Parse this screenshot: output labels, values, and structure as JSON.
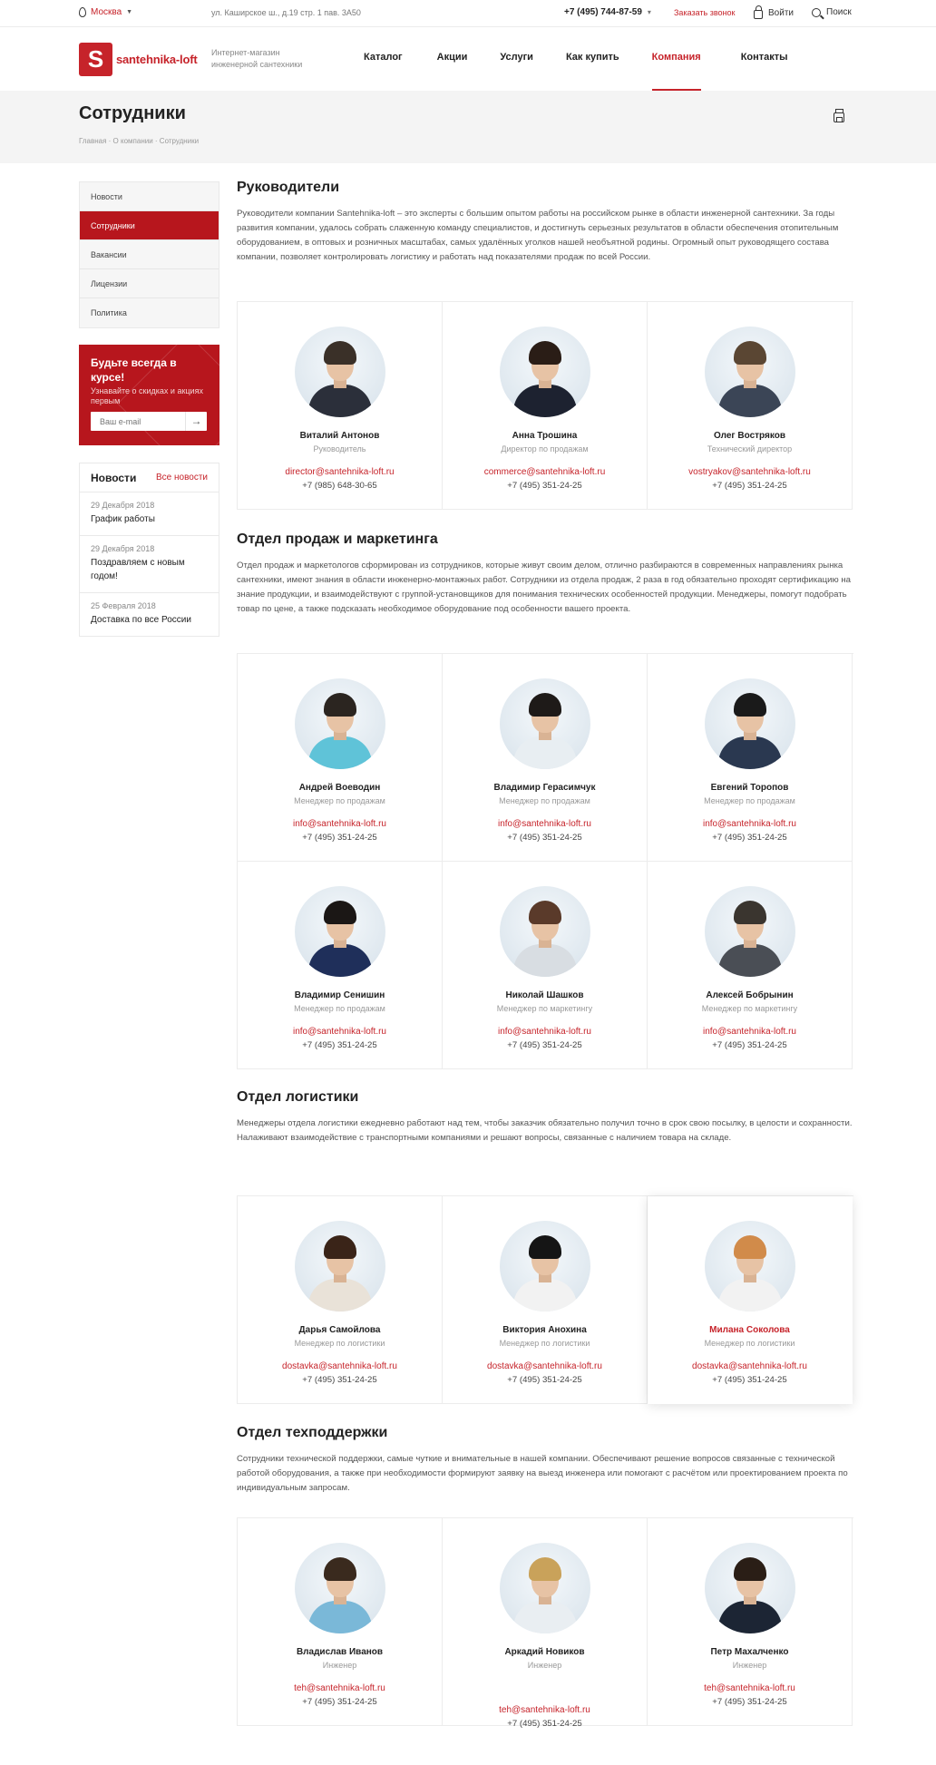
{
  "topbar": {
    "city": "Москва",
    "address": "ул. Каширское ш., д.19 стр. 1 пав. 3А50",
    "phone": "+7 (495) 744-87-59",
    "callback": "Заказать звонок",
    "login": "Войти",
    "search": "Поиск"
  },
  "header": {
    "logo_letter": "S",
    "logo_name": "santehnika-loft",
    "tagline": "Интернет-магазин инженерной сантехники",
    "nav": [
      "Каталог",
      "Акции",
      "Услуги",
      "Как купить",
      "Компания",
      "Контакты"
    ],
    "nav_active": "Компания"
  },
  "page": {
    "title": "Сотрудники",
    "breadcrumb": "Главная  ·  О компании  ·  Сотрудники"
  },
  "sidebar": {
    "menu": [
      "Новости",
      "Сотрудники",
      "Вакансии",
      "Лицензии",
      "Политика"
    ],
    "menu_active": "Сотрудники",
    "subscribe_title": "Будьте всегда в курсе!",
    "subscribe_desc": "Узнавайте о скидках и акциях первым",
    "email_placeholder": "Ваш e-mail",
    "news_title": "Новости",
    "news_all": "Все новости",
    "news": [
      {
        "date": "29 Декабря 2018",
        "title": "График работы"
      },
      {
        "date": "29 Декабря 2018",
        "title": "Поздравляем с новым годом!"
      },
      {
        "date": "25 Февраля 2018",
        "title": "Доставка по все России"
      }
    ]
  },
  "sections": [
    {
      "title": "Руководители",
      "desc": "Руководители компании Santehnika-loft – это эксперты с большим опытом работы на российском рынке в области инженерной сантехники. За годы развития компании, удалось собрать слаженную команду специалистов, и достигнуть серьезных результатов в области обеспечения отопительным оборудованием, в оптовых и розничных масштабах, самых удалённых уголков нашей необъятной родины. Огромный опыт руководящего состава компании, позволяет контролировать логистику и работать над показателями продаж по всей России.",
      "people": [
        {
          "name": "Виталий Антонов",
          "position": "Руководитель",
          "email": "director@santehnika-loft.ru",
          "phone": "+7 (985) 648-30-65"
        },
        {
          "name": "Анна Трошина",
          "position": "Директор по продажам",
          "email": "commerce@santehnika-loft.ru",
          "phone": "+7 (495) 351-24-25"
        },
        {
          "name": "Олег Востряков",
          "position": "Технический директор",
          "email": "vostryakov@santehnika-loft.ru",
          "phone": "+7 (495) 351-24-25"
        }
      ]
    },
    {
      "title": "Отдел продаж и маркетинга",
      "desc": "Отдел продаж и маркетологов сформирован из сотрудников, которые живут своим делом, отлично разбираются в современных направлениях рынка сантехники, имеют знания в области инженерно-монтажных работ. Сотрудники из отдела продаж, 2 раза в год обязательно проходят сертификацию на знание продукции, и взаимодействуют с группой-установщиков для понимания технических особенностей продукции. Менеджеры, помогут подобрать товар по цене, а также подсказать необходимое оборудование под особенности вашего проекта.",
      "people": [
        {
          "name": "Андрей Воеводин",
          "position": "Менеджер по продажам",
          "email": "info@santehnika-loft.ru",
          "phone": "+7 (495) 351-24-25"
        },
        {
          "name": "Владимир Герасимчук",
          "position": "Менеджер по продажам",
          "email": "info@santehnika-loft.ru",
          "phone": "+7 (495) 351-24-25"
        },
        {
          "name": "Евгений Торопов",
          "position": "Менеджер по продажам",
          "email": "info@santehnika-loft.ru",
          "phone": "+7 (495) 351-24-25"
        },
        {
          "name": "Владимир Сенишин",
          "position": "Менеджер по продажам",
          "email": "info@santehnika-loft.ru",
          "phone": "+7 (495) 351-24-25"
        },
        {
          "name": "Николай Шашков",
          "position": "Менеджер по маркетингу",
          "email": "info@santehnika-loft.ru",
          "phone": "+7 (495) 351-24-25"
        },
        {
          "name": "Алексей Бобрынин",
          "position": "Менеджер по маркетингу",
          "email": "info@santehnika-loft.ru",
          "phone": "+7 (495) 351-24-25"
        }
      ]
    },
    {
      "title": "Отдел логистики",
      "desc": "Менеджеры отдела логистики ежедневно работают над тем, чтобы заказчик обязательно получил точно в срок свою посылку, в целости и сохранности. Налаживают взаимодействие с транспортными компаниями и решают вопросы, связанные с наличием товара на складе.",
      "people": [
        {
          "name": "Дарья Самойлова",
          "position": "Менеджер по логистики",
          "email": "dostavka@santehnika-loft.ru",
          "phone": "+7 (495) 351-24-25"
        },
        {
          "name": "Виктория Анохина",
          "position": "Менеджер по логистики",
          "email": "dostavka@santehnika-loft.ru",
          "phone": "+7 (495) 351-24-25"
        },
        {
          "name": "Милана Соколова",
          "position": "Менеджер по логистики",
          "email": "dostavka@santehnika-loft.ru",
          "phone": "+7 (495) 351-24-25"
        }
      ]
    },
    {
      "title": "Отдел техподдержки",
      "desc": "Сотрудники технической поддержки, самые чуткие и внимательные в нашей компании. Обеспечивают решение вопросов связанные с технической работой оборудования, а также при необходимости формируют заявку на выезд инженера или помогают с расчётом или проектированием проекта по индивидуальным запросам.",
      "people": [
        {
          "name": "Владислав Иванов",
          "position": "Инженер",
          "email": "teh@santehnika-loft.ru",
          "phone": "+7 (495) 351-24-25"
        },
        {
          "name": "Аркадий Новиков",
          "position": "Инженер",
          "email": "teh@santehnika-loft.ru",
          "phone": "+7 (495) 351-24-25"
        },
        {
          "name": "Петр Махалченко",
          "position": "Инженер",
          "email": "teh@santehnika-loft.ru",
          "phone": "+7 (495) 351-24-25"
        }
      ]
    }
  ],
  "colors": {
    "accent": "#c6232a",
    "sidebar_active": "#b7161d"
  }
}
